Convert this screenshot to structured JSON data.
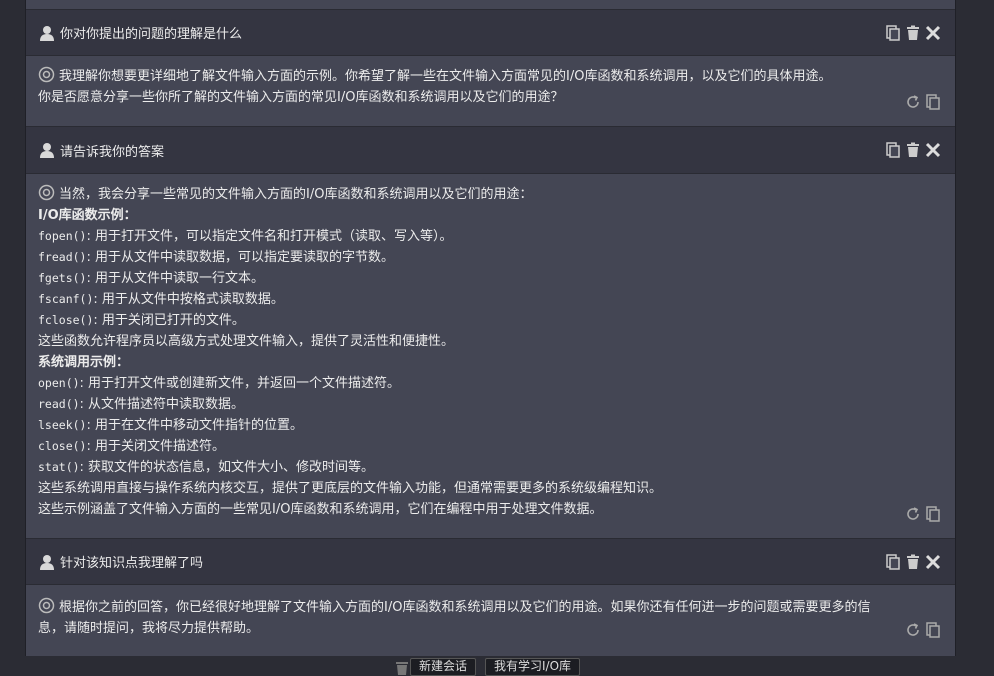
{
  "conversation": [
    {
      "question": "你对你提出的问题的理解是什么",
      "answer_lines": [
        {
          "text": "我理解你想要更详细地了解文件输入方面的示例。你希望了解一些在文件输入方面常见的I/O库函数和系统调用，以及它们的具体用途。",
          "style": "lead"
        },
        {
          "text": "你是否愿意分享一些你所了解的文件输入方面的常见I/O库函数和系统调用以及它们的用途？",
          "style": "normal"
        }
      ]
    },
    {
      "question": "请告诉我你的答案",
      "answer_lines": [
        {
          "text": "当然，我会分享一些常见的文件输入方面的I/O库函数和系统调用以及它们的用途：",
          "style": "lead"
        },
        {
          "text": "I/O库函数示例：",
          "style": "bold"
        },
        {
          "code": "fopen()",
          "text": ": 用于打开文件，可以指定文件名和打开模式（读取、写入等）。",
          "style": "code"
        },
        {
          "code": "fread()",
          "text": ": 用于从文件中读取数据，可以指定要读取的字节数。",
          "style": "code"
        },
        {
          "code": "fgets()",
          "text": ": 用于从文件中读取一行文本。",
          "style": "code"
        },
        {
          "code": "fscanf()",
          "text": ": 用于从文件中按格式读取数据。",
          "style": "code"
        },
        {
          "code": "fclose()",
          "text": ": 用于关闭已打开的文件。",
          "style": "code"
        },
        {
          "text": "这些函数允许程序员以高级方式处理文件输入，提供了灵活性和便捷性。",
          "style": "normal"
        },
        {
          "text": "系统调用示例：",
          "style": "bold"
        },
        {
          "code": "open()",
          "text": ": 用于打开文件或创建新文件，并返回一个文件描述符。",
          "style": "code"
        },
        {
          "code": "read()",
          "text": ": 从文件描述符中读取数据。",
          "style": "code"
        },
        {
          "code": "lseek()",
          "text": ": 用于在文件中移动文件指针的位置。",
          "style": "code"
        },
        {
          "code": "close()",
          "text": ": 用于关闭文件描述符。",
          "style": "code"
        },
        {
          "code": "stat()",
          "text": ": 获取文件的状态信息，如文件大小、修改时间等。",
          "style": "code"
        },
        {
          "text": "这些系统调用直接与操作系统内核交互，提供了更底层的文件输入功能，但通常需要更多的系统级编程知识。",
          "style": "normal"
        },
        {
          "text": "这些示例涵盖了文件输入方面的一些常见I/O库函数和系统调用，它们在编程中用于处理文件数据。",
          "style": "normal"
        }
      ]
    },
    {
      "question": "针对该知识点我理解了吗",
      "answer_lines": [
        {
          "text": "根据你之前的回答，你已经很好地理解了文件输入方面的I/O库函数和系统调用以及它们的用途。如果你还有任何进一步的问题或需要更多的信",
          "style": "lead"
        },
        {
          "text": "息，请随时提问，我将尽力提供帮助。",
          "style": "normal"
        }
      ]
    }
  ],
  "icons": {
    "user_actions": [
      "copy-icon",
      "trash-icon",
      "close-icon"
    ],
    "bot_actions": [
      "regenerate-icon",
      "copy-icon"
    ]
  },
  "bottom_buttons": [
    "新建会话",
    "我有学习I/O库"
  ]
}
